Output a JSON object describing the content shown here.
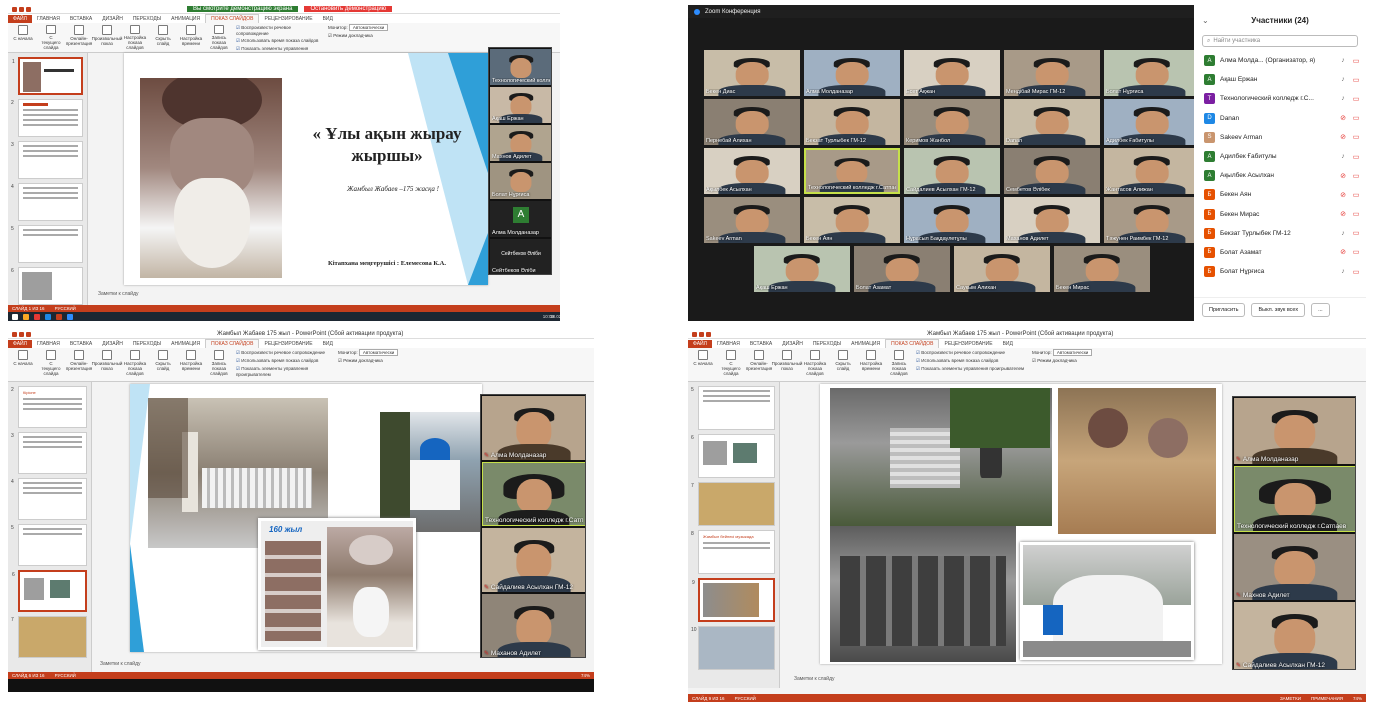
{
  "q1": {
    "title_bar": "Вы смотрите демонстрацию экрана",
    "stop_share": "Остановить демонстрацию",
    "tabs": [
      "ФАЙЛ",
      "ГЛАВНАЯ",
      "ВСТАВКА",
      "ДИЗАЙН",
      "ПЕРЕХОДЫ",
      "АНИМАЦИЯ",
      "ПОКАЗ СЛАЙДОВ",
      "РЕЦЕНЗИРОВАНИЕ",
      "ВИД"
    ],
    "ribbon_buttons": [
      "С начала",
      "С текущего слайда",
      "Онлайн-презентация",
      "Произвольный показ",
      "Настройка показа слайдов",
      "Скрыть слайд",
      "Настройка времени",
      "Запись показа слайдов"
    ],
    "ribbon_checks": [
      "Воспроизвести речевое сопровождение",
      "Использовать время показа слайдов",
      "Показать элементы управления проигрывателем"
    ],
    "monitor_label": "Монитор:",
    "monitor_value": "Автоматически",
    "presenter_view": "Режим докладчика",
    "slide_title": "« Ұлы ақын жырау жыршы»",
    "slide_subtitle": "Жамбыл Жабаев –175 жасқа !",
    "slide_author": "Кітапхана меңгерушісі : Елемесова К.А.",
    "thumb_title": "Кіріспе",
    "notes": "Заметки к слайду",
    "status_left": "СЛАЙД 1 ИЗ 16",
    "status_lang": "РУССКИЙ",
    "clock": "10:09",
    "date": "18.02.2022",
    "video_names": [
      "Технологический колледж г.Сатпаев",
      "Ақаш Ержан",
      "Махнов Адилет",
      "Болат Нұрғиса",
      "Алма Молданазар",
      "Сейтбеков Әліби",
      "Сейтбеков Әліби"
    ]
  },
  "q2": {
    "app_title": "Zoom Конференция",
    "grid": [
      [
        "Бекен Диас",
        "Алма Молданазар",
        "Есет Ақжан",
        "Мендібай Мирас ГМ-12",
        "Болат Нұрғиса"
      ],
      [
        "Пернебай Алихан",
        "Бекзат Турлыбек ГМ-12",
        "Керимов Жанбол",
        "Danan",
        "Адилбек Ғабитулы"
      ],
      [
        "Ақылбек Асылхан",
        "Технологический колледж г.Сатпаев",
        "Сайдалиев Асылхан ГМ-12",
        "Сембетов Әлібек",
        "Жантасов Алижан"
      ],
      [
        "Sakeev Arman",
        "Бекен Аян",
        "Нұрасыл Бақдаулетұлы",
        "Маханов Адилет",
        "Тәжунен Раимбек ГМ-12"
      ],
      [
        "Ақаш Ержан",
        "Болат Азамат",
        "Саукым Алихан",
        "Бекен Мирас"
      ]
    ],
    "panel_title": "Участники (24)",
    "search_placeholder": "Найти участника",
    "participants": [
      {
        "initial": "А",
        "name": "Алма Молда... (Организатор, я)",
        "color": "#2e7d32",
        "muted": false
      },
      {
        "initial": "А",
        "name": "Ақаш Ержан",
        "color": "#2e7d32",
        "muted": false
      },
      {
        "initial": "Т",
        "name": "Технологический колледж г.С...",
        "color": "#7b1fa2",
        "muted": false
      },
      {
        "initial": "D",
        "name": "Danan",
        "color": "#1e88e5",
        "muted": true
      },
      {
        "initial": "S",
        "name": "Sakeev Arman",
        "color": "#c9956e",
        "muted": true
      },
      {
        "initial": "А",
        "name": "Адилбек Ғабитулы",
        "color": "#2e7d32",
        "muted": false
      },
      {
        "initial": "А",
        "name": "Ақылбек Асылхан",
        "color": "#2e7d32",
        "muted": true
      },
      {
        "initial": "Б",
        "name": "Бекен Аян",
        "color": "#e65100",
        "muted": true
      },
      {
        "initial": "Б",
        "name": "Бекен Мирас",
        "color": "#e65100",
        "muted": true
      },
      {
        "initial": "Б",
        "name": "Бекзат Турлыбек ГМ-12",
        "color": "#e65100",
        "muted": false
      },
      {
        "initial": "Б",
        "name": "Болат Азамат",
        "color": "#e65100",
        "muted": true
      },
      {
        "initial": "Б",
        "name": "Болат Нұрғиса",
        "color": "#e65100",
        "muted": false
      }
    ],
    "invite": "Пригласить",
    "mute_all": "Выкл. звук всех",
    "more": "..."
  },
  "q3": {
    "title": "Жамбыл Жабаев 175 жыл - PowerPoint (Сбой активации продукта)",
    "tabs": [
      "ФАЙЛ",
      "ГЛАВНАЯ",
      "ВСТАВКА",
      "ДИЗАЙН",
      "ПЕРЕХОДЫ",
      "АНИМАЦИЯ",
      "ПОКАЗ СЛАЙДОВ",
      "РЕЦЕНЗИРОВАНИЕ",
      "ВИД"
    ],
    "group_start": "Начать показ слайдов",
    "group_setup": "Настройка",
    "group_monitors": "Мониторы",
    "thumb_numbers": [
      "2",
      "3",
      "4",
      "5",
      "6",
      "7"
    ],
    "thumb_title": "Кіріспе",
    "book_sign": "160 жыл",
    "video_names": [
      "Алма Молданазар",
      "Технологический колледж г.Сатпаев",
      "Сайдалиев Асылхан ГМ-12",
      "Маханов Адилет"
    ],
    "notes": "Заметки к слайду",
    "status_left": "СЛАЙД 6 ИЗ 16",
    "status_lang": "РУССКИЙ",
    "zoom_pct": "74%"
  },
  "q4": {
    "title": "Жамбыл Жабаев 175 жыл - PowerPoint (Сбой активации продукта)",
    "tabs": [
      "ФАЙЛ",
      "ГЛАВНАЯ",
      "ВСТАВКА",
      "ДИЗАЙН",
      "ПЕРЕХОДЫ",
      "АНИМАЦИЯ",
      "ПОКАЗ СЛАЙДОВ",
      "РЕЦЕНЗИРОВАНИЕ",
      "ВИД"
    ],
    "thumb_numbers": [
      "5",
      "6",
      "7",
      "8",
      "9",
      "10"
    ],
    "thumb_title": "Жамбыл бейнесі музыкада",
    "video_names": [
      "Алма Молданазар",
      "Технологический колледж г.Сатпаев",
      "Махнов Адилет",
      "Сайдалиев Асылхан ГМ-12"
    ],
    "notes": "Заметки к слайду",
    "status_left": "СЛАЙД 9 ИЗ 16",
    "status_lang": "РУССКИЙ",
    "status_notes": "ЗАМЕТКИ",
    "status_comments": "ПРИМЕЧАНИЯ",
    "zoom_pct": "74%"
  }
}
